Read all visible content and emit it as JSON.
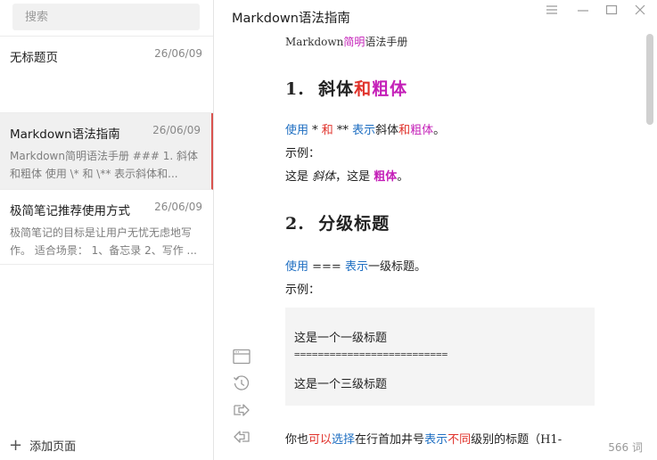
{
  "search": {
    "placeholder": "搜索"
  },
  "notes": [
    {
      "title": "无标题页",
      "date": "26/06/09",
      "snippet": ""
    },
    {
      "title": "Markdown语法指南",
      "date": "26/06/09",
      "snippet": "Markdown简明语法手册 ### 1. 斜体和粗体 使用 \\* 和 \\** 表示斜体和..."
    },
    {
      "title": "极简笔记推荐使用方式",
      "date": "26/06/09",
      "snippet": "极简笔记的目标是让用户无忧无虑地写作。 适合场景： 1、备忘录 2、写作 ..."
    }
  ],
  "add_page": {
    "label": "添加页面"
  },
  "doc": {
    "title": "Markdown语法指南",
    "subtitle_a": "Markdown",
    "subtitle_b": "简明",
    "subtitle_c": "语法手册",
    "h1_num": "1.",
    "h1_a": "斜体",
    "h1_b": "和",
    "h1_c": "粗体",
    "p1_a": "使用",
    "p1_b": " * ",
    "p1_c": "和",
    "p1_d": " ** ",
    "p1_e": "表示",
    "p1_f": "斜体",
    "p1_g": "和",
    "p1_h": "粗体",
    "p1_i": "。",
    "example_label": "示例：",
    "ex_a": "这是 ",
    "ex_b": "斜体",
    "ex_c": "，这是 ",
    "ex_d": "粗体",
    "ex_e": "。",
    "h2_num": "2.",
    "h2_text": "分级标题",
    "p2_a": "使用",
    "p2_b": " === ",
    "p2_c": "表示",
    "p2_d": "一级标题。",
    "example_label2": "示例：",
    "code_line1": "这是一个一级标题",
    "code_line2": "==========================",
    "code_line3": "这是一个三级标题",
    "p3_a": "你也",
    "p3_b": "可以",
    "p3_c": "选择",
    "p3_d": "在行首加井号",
    "p3_e": "表示",
    "p3_f": "不同",
    "p3_g": "级别的标题（H1-"
  },
  "word_count": "566 词",
  "colors": {
    "blue": "#1f6fc2",
    "red": "#e0322b",
    "magenta": "#c41fb8",
    "accent_bar": "#d9534f"
  },
  "icons": [
    "menu-icon",
    "minimize-icon",
    "maximize-icon",
    "close-icon",
    "browser-window-icon",
    "history-icon",
    "share-out-icon",
    "share-in-icon",
    "plus-icon"
  ]
}
